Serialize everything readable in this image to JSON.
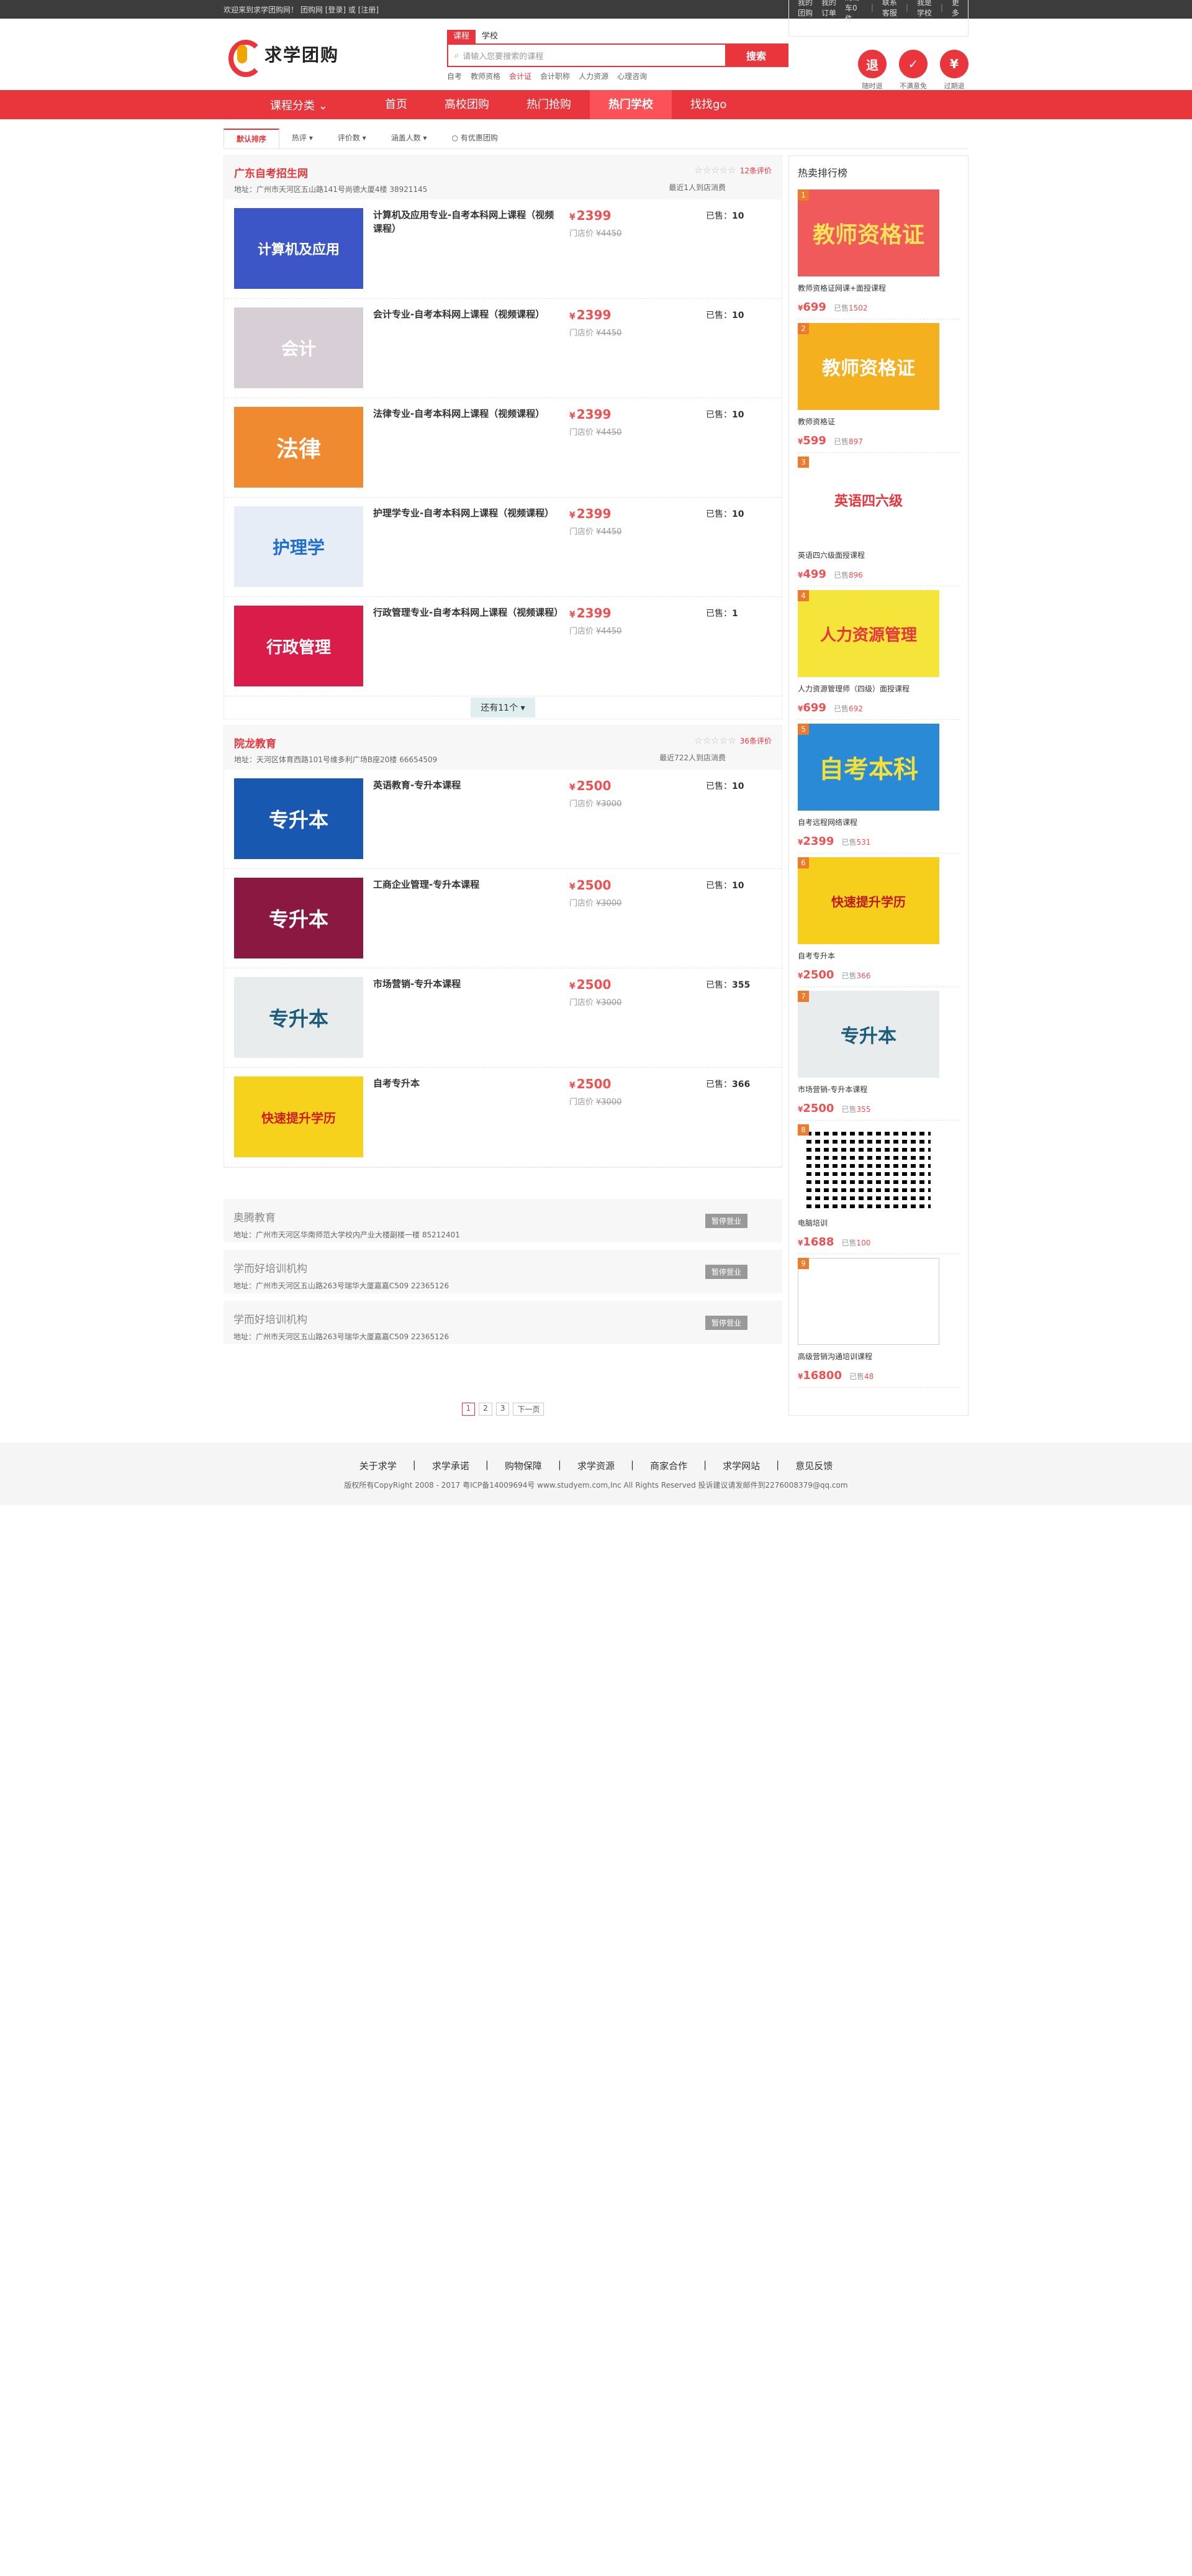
{
  "topbar": {
    "welcome": "欢迎来到求学团购网！",
    "cart": "团购网",
    "login": "[登录]",
    "or": "或",
    "register": "[注册]",
    "links": [
      "我的团购",
      "我的订单",
      "购物车0件",
      "联系客服",
      "我是学校",
      "更多"
    ]
  },
  "header": {
    "logo": "求学团购",
    "search": {
      "tab_course": "课程",
      "tab_school": "学校",
      "placeholder": "请输入您要搜索的课程",
      "button": "搜索",
      "hot": [
        "自考",
        "教师资格",
        "会计证",
        "会计职称",
        "人力资源",
        "心理咨询"
      ]
    },
    "promises": [
      {
        "icon": "退",
        "label": "随时退"
      },
      {
        "icon": "✓",
        "label": "不满意免"
      },
      {
        "icon": "¥",
        "label": "过期退"
      }
    ]
  },
  "nav": {
    "category": "课程分类",
    "items": [
      "首页",
      "高校团购",
      "热门抢购",
      "热门学校",
      "找找go"
    ]
  },
  "filter": [
    "默认排序",
    "热评 ▾",
    "评价数 ▾",
    "涵盖人数 ▾",
    "有优惠团购"
  ],
  "orgs": [
    {
      "name": "广东自考招生网",
      "addr": "地址：广州市天河区五山路141号尚德大厦4楼 38921145",
      "stars": "☆☆☆☆☆",
      "reviews": "12条评价",
      "recent": "最近1人到店消费",
      "courses": [
        {
          "thumb": "计算机及应用",
          "title": "计算机及应用专业-自考本科网上课程（视频课程）",
          "price": "2399",
          "orig_label": "门店价",
          "orig": "¥4450",
          "sold_label": "已售：",
          "sold": "10"
        },
        {
          "thumb": "会计",
          "title": "会计专业-自考本科网上课程（视频课程）",
          "price": "2399",
          "orig_label": "门店价",
          "orig": "¥4450",
          "sold_label": "已售：",
          "sold": "10"
        },
        {
          "thumb": "法律",
          "title": "法律专业-自考本科网上课程（视频课程）",
          "price": "2399",
          "orig_label": "门店价",
          "orig": "¥4450",
          "sold_label": "已售：",
          "sold": "10"
        },
        {
          "thumb": "护理学",
          "title": "护理学专业-自考本科网上课程（视频课程）",
          "price": "2399",
          "orig_label": "门店价",
          "orig": "¥4450",
          "sold_label": "已售：",
          "sold": "10"
        },
        {
          "thumb": "行政管理",
          "title": "行政管理专业-自考本科网上课程（视频课程）",
          "price": "2399",
          "orig_label": "门店价",
          "orig": "¥4450",
          "sold_label": "已售：",
          "sold": "1"
        }
      ],
      "more": "还有11个 ▾"
    },
    {
      "name": "院龙教育",
      "addr": "地址：天河区体育西路101号维多利广场B座20楼 66654509",
      "stars": "☆☆☆☆☆",
      "reviews": "36条评价",
      "recent": "最近722人到店消费",
      "courses": [
        {
          "thumb": "专升本",
          "title": "英语教育-专升本课程",
          "price": "2500",
          "orig_label": "门店价",
          "orig": "¥3000",
          "sold_label": "已售：",
          "sold": "10"
        },
        {
          "thumb": "专升本",
          "title": "工商企业管理-专升本课程",
          "price": "2500",
          "orig_label": "门店价",
          "orig": "¥3000",
          "sold_label": "已售：",
          "sold": "10"
        },
        {
          "thumb": "专升本",
          "title": "市场营销-专升本课程",
          "price": "2500",
          "orig_label": "门店价",
          "orig": "¥3000",
          "sold_label": "已售：",
          "sold": "355"
        },
        {
          "thumb": "快速提升学历",
          "title": "自考专升本",
          "price": "2500",
          "orig_label": "门店价",
          "orig": "¥3000",
          "sold_label": "已售：",
          "sold": "366"
        }
      ]
    }
  ],
  "mini_orgs": [
    {
      "name": "奥腾教育",
      "addr": "地址：广州市天河区华南师范大学校内产业大楼副楼一楼 85212401",
      "btn": "暂停营业"
    },
    {
      "name": "学而好培训机构",
      "addr": "地址：广州市天河区五山路263号瑞华大厦嘉嘉C509 22365126",
      "btn": "暂停营业"
    },
    {
      "name": "学而好培训机构",
      "addr": "地址：广州市天河区五山路263号瑞华大厦嘉嘉C509 22365126",
      "btn": "暂停营业"
    }
  ],
  "pagination": [
    "1",
    "2",
    "3",
    "下一页"
  ],
  "sidebar": {
    "title": "热卖排行榜",
    "items": [
      {
        "num": "1",
        "img": "教师资格证",
        "title": "教师资格证网课+面授课程",
        "price": "699",
        "sold_label": "已售",
        "sold": "1502"
      },
      {
        "num": "2",
        "img": "教师资格证",
        "title": "教师资格证",
        "price": "599",
        "sold_label": "已售",
        "sold": "897"
      },
      {
        "num": "3",
        "img": "英语四六级",
        "title": "英语四六级面授课程",
        "price": "499",
        "sold_label": "已售",
        "sold": "896"
      },
      {
        "num": "4",
        "img": "人力资源管理",
        "title": "人力资源管理师（四级）面授课程",
        "price": "699",
        "sold_label": "已售",
        "sold": "692"
      },
      {
        "num": "5",
        "img": "自考本科",
        "title": "自考远程网络课程",
        "price": "2399",
        "sold_label": "已售",
        "sold": "531"
      },
      {
        "num": "6",
        "img": "快速提升学历",
        "title": "自考专升本",
        "price": "2500",
        "sold_label": "已售",
        "sold": "366"
      },
      {
        "num": "7",
        "img": "专升本",
        "title": "市场营销-专升本课程",
        "price": "2500",
        "sold_label": "已售",
        "sold": "355"
      },
      {
        "num": "8",
        "img": "",
        "title": "电脑培训",
        "price": "1688",
        "sold_label": "已售",
        "sold": "100"
      },
      {
        "num": "9",
        "img": "",
        "title": "高级营销沟通培训课程",
        "price": "16800",
        "sold_label": "已售",
        "sold": "48"
      }
    ]
  },
  "footer": {
    "links": [
      "关于求学",
      "求学承诺",
      "购物保障",
      "求学资源",
      "商家合作",
      "求学网站",
      "意见反馈"
    ],
    "copy": "版权所有CopyRight 2008 - 2017 粤ICP备14009694号 www.studyem.com,Inc All Rights Reserved 投诉建议请发邮件到2276008379@qq.com"
  }
}
